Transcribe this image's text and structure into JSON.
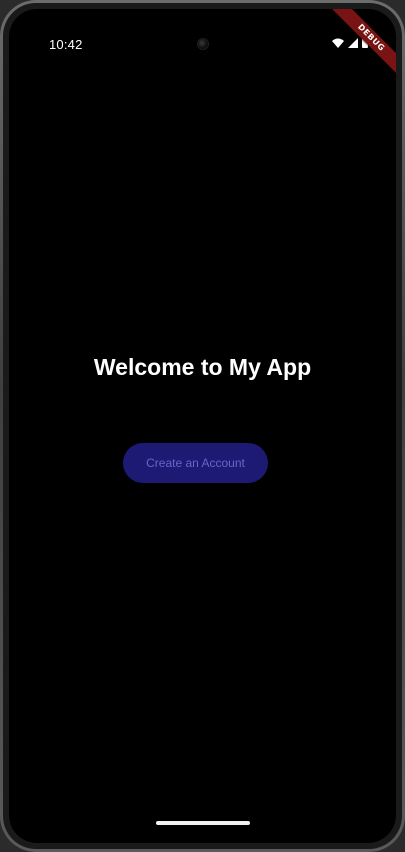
{
  "status_bar": {
    "time": "10:42",
    "icons": [
      "wifi-icon",
      "cellular-signal-icon",
      "battery-icon"
    ]
  },
  "debug_banner": {
    "label": "DEBUG",
    "color": "#7a1414"
  },
  "main": {
    "title": "Welcome to My App",
    "create_account_label": "Create an Account"
  },
  "colors": {
    "background": "#000000",
    "button_background": "#1c1a73",
    "button_text": "#6b64c9",
    "title_text": "#ffffff"
  }
}
